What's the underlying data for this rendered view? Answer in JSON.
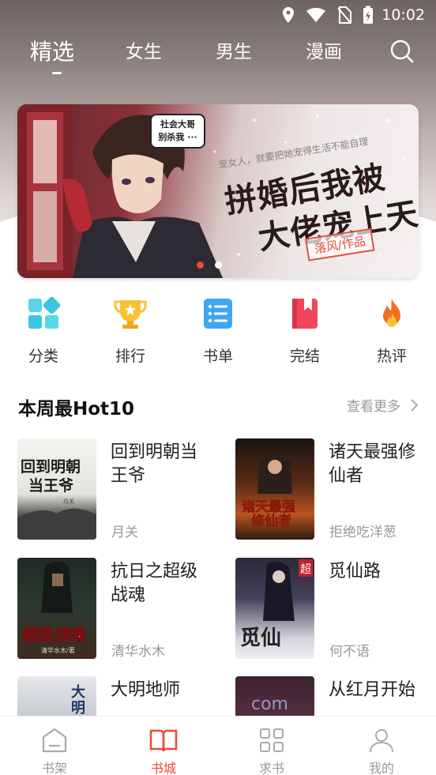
{
  "status_bar": {
    "time": "10:02"
  },
  "top_tabs": [
    {
      "label": "精选",
      "active": true
    },
    {
      "label": "女生",
      "active": false
    },
    {
      "label": "男生",
      "active": false
    },
    {
      "label": "漫画",
      "active": false
    }
  ],
  "banner": {
    "speech": "社会大哥\n别杀我 ...",
    "subtitle": "宠女人，就要把她宠得生活不能自理",
    "title_line1": "拼婚后我被",
    "title_line2": "大佬宠上天",
    "author": "落风/作品",
    "pagination": {
      "current": 1,
      "total": 2
    }
  },
  "categories": [
    {
      "label": "分类",
      "icon": "grid-icon",
      "color": "#3dc9e6"
    },
    {
      "label": "排行",
      "icon": "trophy-icon",
      "color": "#f5b82b"
    },
    {
      "label": "书单",
      "icon": "list-icon",
      "color": "#3aa2f0"
    },
    {
      "label": "完结",
      "icon": "bookmark-book-icon",
      "color": "#f0455a"
    },
    {
      "label": "热评",
      "icon": "flame-icon",
      "color": "#f06a23"
    }
  ],
  "hot_section": {
    "title": "本周最Hot10",
    "more": "查看更多"
  },
  "books": [
    {
      "title": "回到明朝当王爷",
      "author": "月关",
      "cover_text": "回到明朝当王爷"
    },
    {
      "title": "诸天最强修仙者",
      "author": "拒绝吃洋葱",
      "cover_text": "诸天最强修仙者"
    },
    {
      "title": "抗日之超级战魂",
      "author": "清华水木",
      "cover_text": "超级战魂"
    },
    {
      "title": "觅仙路",
      "author": "何不语",
      "cover_text": "觅仙路"
    },
    {
      "title": "大明地师",
      "author": "",
      "cover_text": "大明"
    },
    {
      "title": "从红月开始",
      "author": "",
      "cover_text": ""
    }
  ],
  "bottom_nav": [
    {
      "label": "书架",
      "icon": "shelf-icon",
      "active": false
    },
    {
      "label": "书城",
      "icon": "open-book-icon",
      "active": true
    },
    {
      "label": "求书",
      "icon": "apps-grid-icon",
      "active": false
    },
    {
      "label": "我的",
      "icon": "user-icon",
      "active": false
    }
  ],
  "colors": {
    "accent": "#e94c34",
    "muted": "#999999"
  }
}
